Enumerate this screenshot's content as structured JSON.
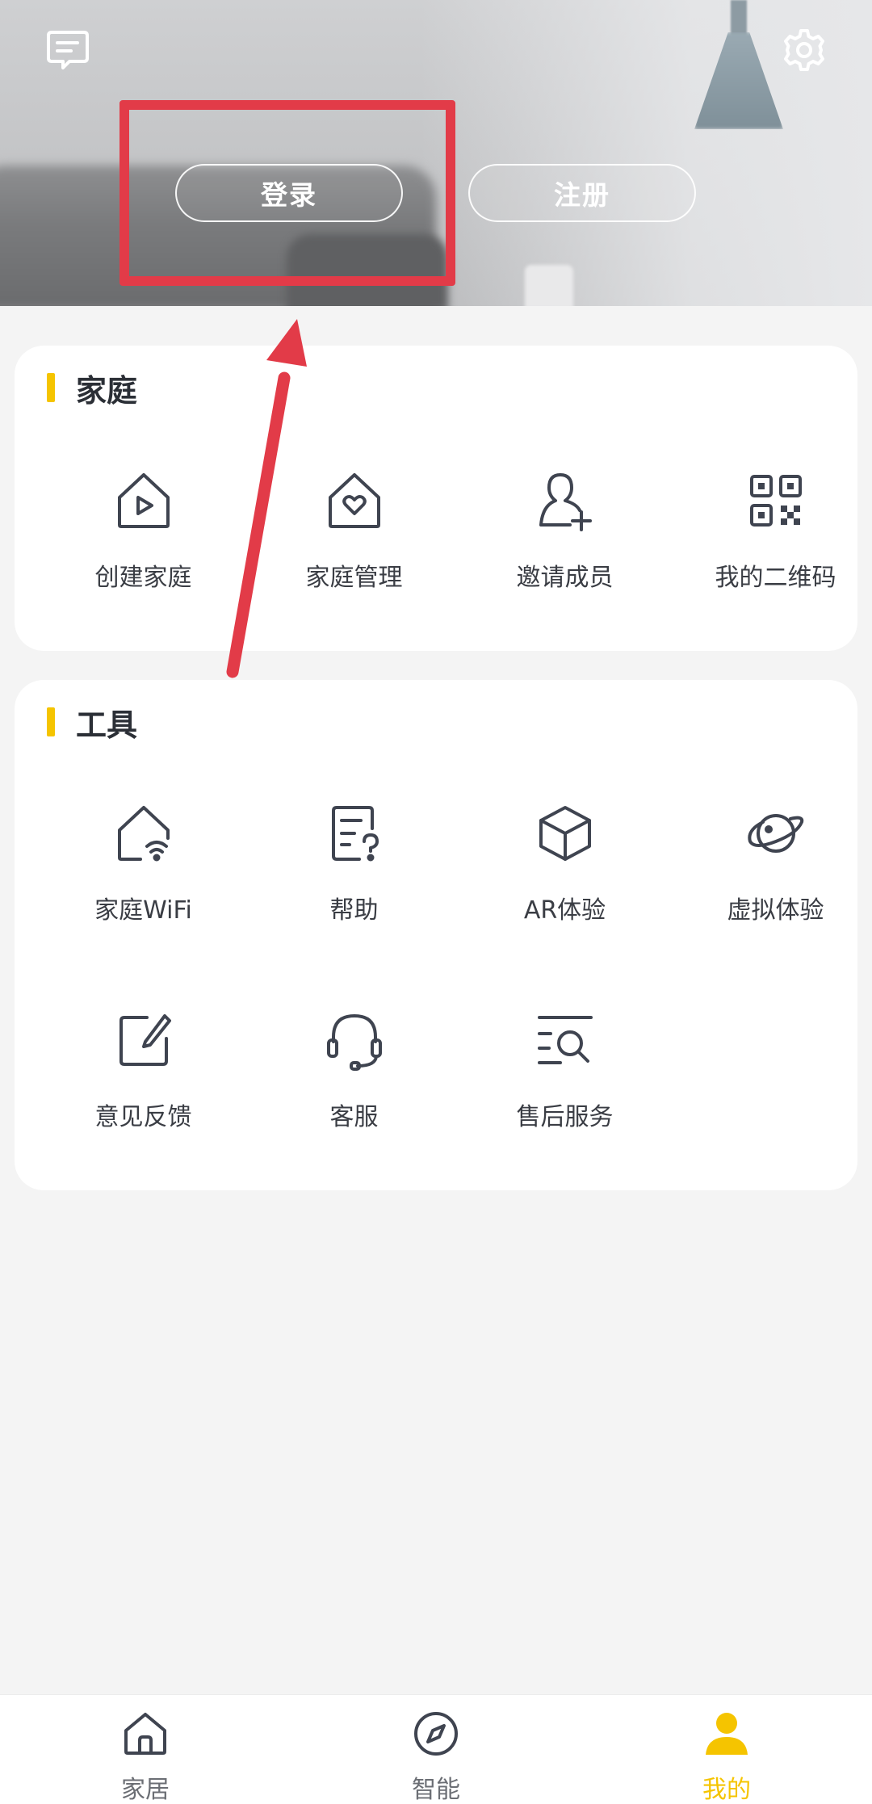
{
  "header": {
    "login_label": "登录",
    "register_label": "注册",
    "icons": [
      "message-icon",
      "settings-gear-icon"
    ]
  },
  "family_section": {
    "title": "家庭",
    "items": [
      {
        "label": "创建家庭",
        "icon": "house-play-icon"
      },
      {
        "label": "家庭管理",
        "icon": "house-heart-icon"
      },
      {
        "label": "邀请成员",
        "icon": "person-add-icon"
      },
      {
        "label": "我的二维码",
        "icon": "qr-code-icon"
      }
    ]
  },
  "tools_section": {
    "title": "工具",
    "items": [
      {
        "label": "家庭WiFi",
        "icon": "house-wifi-icon"
      },
      {
        "label": "帮助",
        "icon": "help-document-icon"
      },
      {
        "label": "AR体验",
        "icon": "cube-icon"
      },
      {
        "label": "虚拟体验",
        "icon": "planet-icon"
      },
      {
        "label": "意见反馈",
        "icon": "feedback-edit-icon"
      },
      {
        "label": "客服",
        "icon": "headset-icon"
      },
      {
        "label": "售后服务",
        "icon": "service-search-icon"
      }
    ]
  },
  "bottom_nav": {
    "items": [
      {
        "label": "家居",
        "icon": "home-icon",
        "active": false
      },
      {
        "label": "智能",
        "icon": "compass-icon",
        "active": false
      },
      {
        "label": "我的",
        "icon": "person-icon",
        "active": true
      }
    ]
  },
  "colors": {
    "accent": "#f5c400",
    "annotation_red": "#e23b48",
    "icon_stroke": "#3f4450",
    "background": "#f4f4f4"
  }
}
